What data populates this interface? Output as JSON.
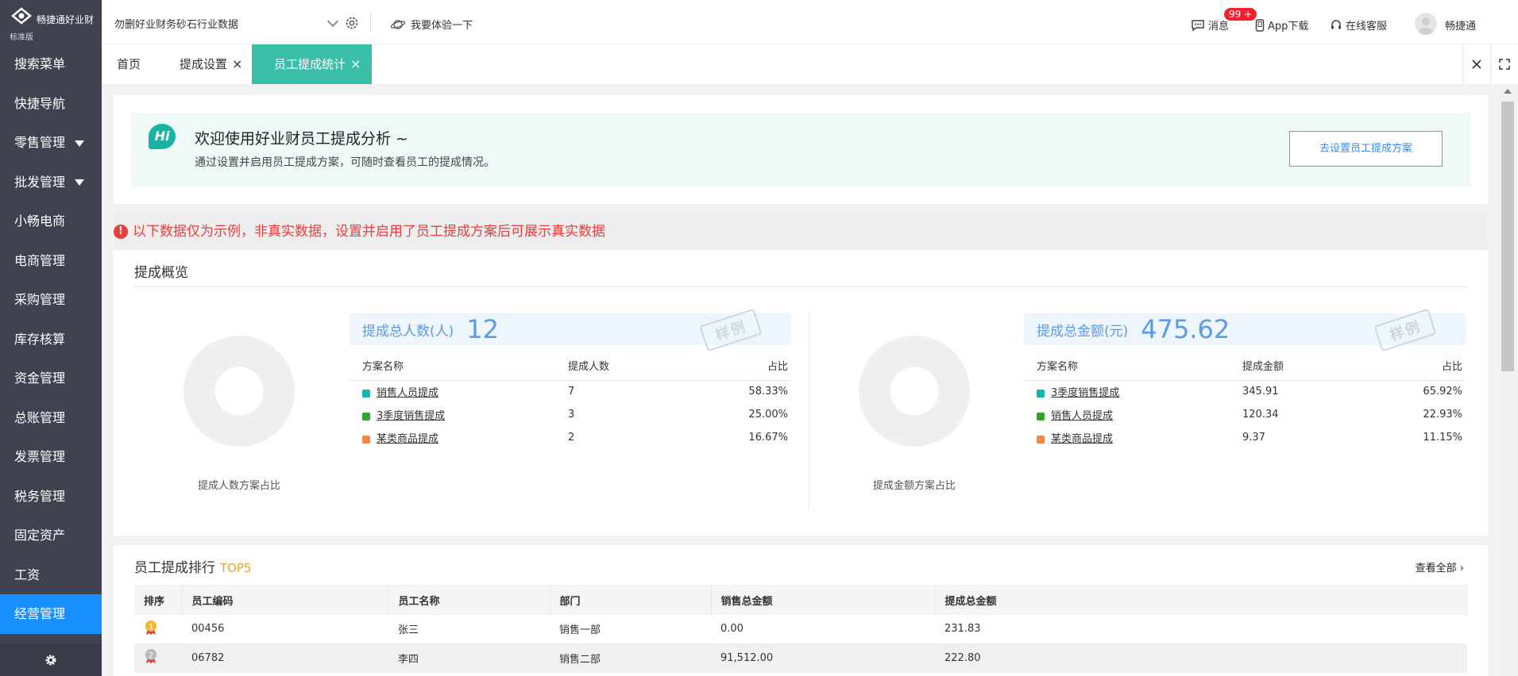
{
  "sidebar": {
    "brand": "畅捷通好业财",
    "edition": "标准版",
    "items": [
      {
        "label": "搜索菜单"
      },
      {
        "label": "快捷导航"
      },
      {
        "label": "零售管理"
      },
      {
        "label": "批发管理"
      },
      {
        "label": "小畅电商"
      },
      {
        "label": "电商管理"
      },
      {
        "label": "采购管理"
      },
      {
        "label": "库存核算"
      },
      {
        "label": "资金管理"
      },
      {
        "label": "总账管理"
      },
      {
        "label": "发票管理"
      },
      {
        "label": "税务管理"
      },
      {
        "label": "固定资产"
      },
      {
        "label": "工资"
      },
      {
        "label": "经营管理"
      }
    ]
  },
  "topbar": {
    "company": "勿删好业财务砂石行业数据",
    "try_label": "我要体验一下",
    "messages_label": "消息",
    "messages_badge": "99 +",
    "app_download": "App下载",
    "online_service": "在线客服",
    "user": "畅捷通"
  },
  "tabs": [
    {
      "label": "首页"
    },
    {
      "label": "提成设置",
      "close": "×"
    },
    {
      "label": "员工提成统计",
      "close": "×"
    }
  ],
  "welcome": {
    "hi": "Hi",
    "title": "欢迎使用好业财员工提成分析 ~",
    "subtitle": "通过设置并启用员工提成方案，可随时查看员工的提成情况。",
    "button": "去设置员工提成方案"
  },
  "warning": "以下数据仅为示例，非真实数据，设置并启用了员工提成方案后可展示真实数据",
  "overview": {
    "title": "提成概览",
    "stamp": "样例",
    "people": {
      "donut_label": "提成人数方案占比",
      "head_label": "提成总人数(人)",
      "head_value": "12",
      "columns": [
        "方案名称",
        "提成人数",
        "占比"
      ],
      "rows": [
        {
          "name": "销售人员提成",
          "count": "7",
          "ratio": "58.33%",
          "color": "#13b5b1"
        },
        {
          "name": "3季度销售提成",
          "count": "3",
          "ratio": "25.00%",
          "color": "#2aaa2a"
        },
        {
          "name": "某类商品提成",
          "count": "2",
          "ratio": "16.67%",
          "color": "#f5883d"
        }
      ]
    },
    "amount": {
      "donut_label": "提成金额方案占比",
      "head_label": "提成总金额(元)",
      "head_value": "475.62",
      "columns": [
        "方案名称",
        "提成金额",
        "占比"
      ],
      "rows": [
        {
          "name": "3季度销售提成",
          "count": "345.91",
          "ratio": "65.92%",
          "color": "#13b5b1"
        },
        {
          "name": "销售人员提成",
          "count": "120.34",
          "ratio": "22.93%",
          "color": "#2aaa2a"
        },
        {
          "name": "某类商品提成",
          "count": "9.37",
          "ratio": "11.15%",
          "color": "#f5883d"
        }
      ]
    }
  },
  "ranking": {
    "title": "员工提成排行",
    "top": "TOP5",
    "view_all": "查看全部",
    "columns": [
      "排序",
      "员工编码",
      "员工名称",
      "部门",
      "销售总金额",
      "提成总金额"
    ],
    "rows": [
      {
        "rank": "1",
        "code": "00456",
        "name": "张三",
        "dept": "销售一部",
        "sales": "0.00",
        "commission": "231.83"
      },
      {
        "rank": "2",
        "code": "06782",
        "name": "李四",
        "dept": "销售二部",
        "sales": "91,512.00",
        "commission": "222.80"
      }
    ]
  },
  "colors": {
    "sidebar_bg": "#3f424f",
    "active_menu": "#1890ff",
    "active_tab": "#3bbfa9",
    "warning": "#ee3b3b",
    "accent_blue": "#5a9be8"
  }
}
